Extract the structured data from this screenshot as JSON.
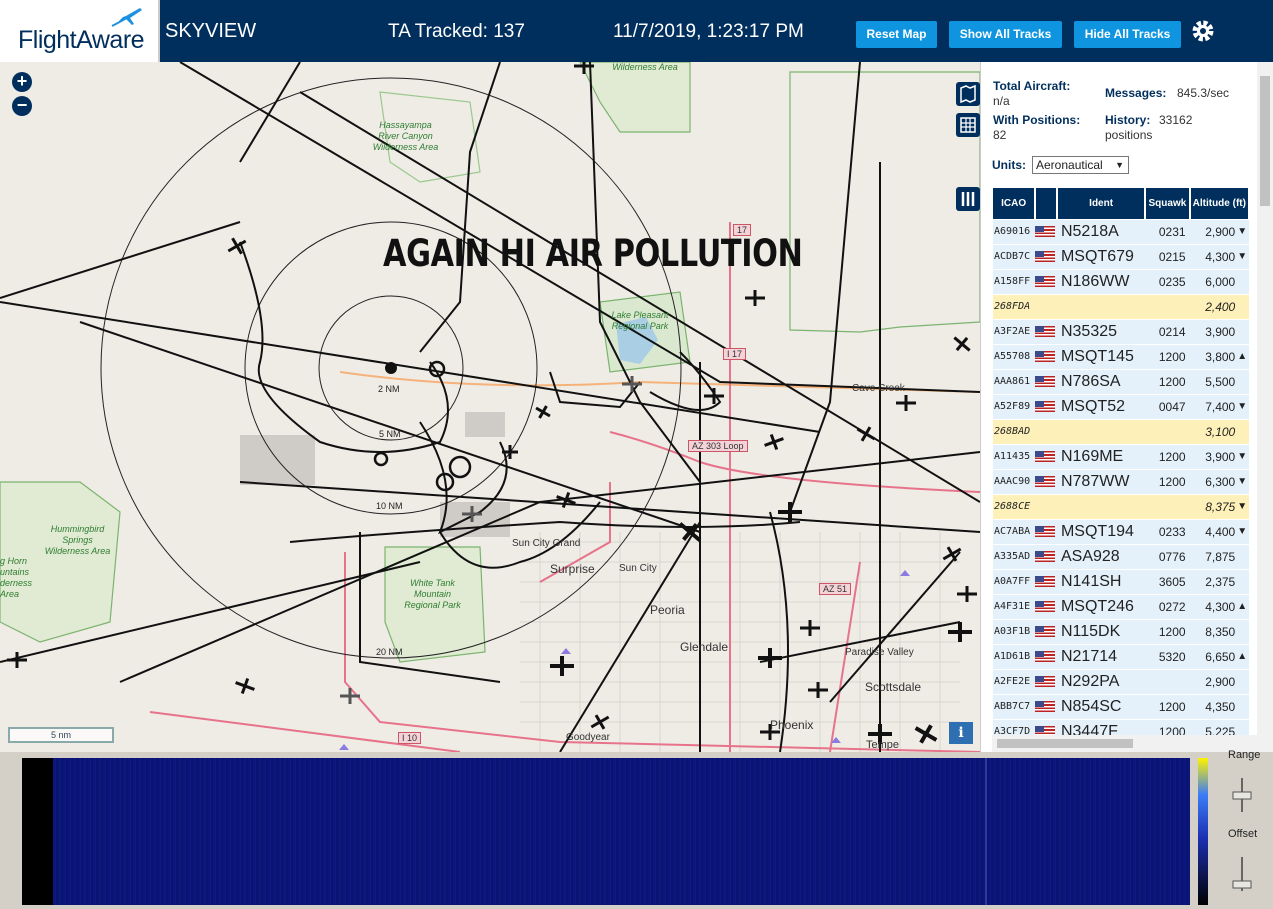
{
  "header": {
    "logo": "FlightAware",
    "app_title": "SKYVIEW",
    "ta_tracked": "TA Tracked: 137",
    "clock": "11/7/2019, 1:23:17 PM",
    "buttons": {
      "reset": "Reset Map",
      "show": "Show All Tracks",
      "hide": "Hide All Tracks"
    },
    "icons": [
      "plane-logo-icon",
      "gear-icon"
    ],
    "colors": {
      "header_bg": "#002f5d",
      "button": "#0f95e0"
    }
  },
  "map": {
    "zoom_in": "+",
    "zoom_out": "−",
    "overlay": "AGAIN HI AIR POLLUTION",
    "scale": "5 nm",
    "info": "i",
    "rings": [
      "2 NM",
      "5 NM",
      "10 NM",
      "20 NM"
    ],
    "places": [
      "Cave Creek",
      "Sun City Grand",
      "Surprise",
      "Sun City",
      "Peoria",
      "Glendale",
      "Paradise Valley",
      "Scottsdale",
      "Phoenix",
      "Tempe",
      "Goodyear"
    ],
    "wilderness": [
      "Wilderness Area",
      "Hassayampa River Canyon Wilderness Area",
      "Lake Pleasant Regional Park",
      "Hummingbird Springs Wilderness Area",
      "White Tank Mountain Regional Park",
      "g Horn untains derness Area"
    ],
    "shields": [
      "17",
      "I 17",
      "AZ 303 Loop",
      "AZ 51",
      "I 10"
    ],
    "icons": [
      "map-layers-icon",
      "grid-icon",
      "columns-icon"
    ]
  },
  "panel": {
    "total_label": "Total Aircraft:",
    "total_value": "n/a",
    "with_pos_label": "With Positions:",
    "with_pos_value": "82",
    "messages_label": "Messages:",
    "messages_value": "845.3/sec",
    "history_label": "History:",
    "history_value": "33162",
    "history_unit": "positions",
    "units_label": "Units:",
    "units_value": "Aeronautical",
    "columns": [
      "ICAO",
      "Ident",
      "Squawk",
      "Altitude (ft)"
    ],
    "rows": [
      {
        "icao": "A69016",
        "flag": true,
        "ident": "N5218A",
        "squawk": "0231",
        "alt": "2,900",
        "trend": "▼"
      },
      {
        "icao": "ACDB7C",
        "flag": true,
        "ident": "MSQT679",
        "squawk": "0215",
        "alt": "4,300",
        "trend": "▼"
      },
      {
        "icao": "A158FF",
        "flag": true,
        "ident": "N186WW",
        "squawk": "0235",
        "alt": "6,000",
        "trend": ""
      },
      {
        "icao": "268FDA",
        "flag": false,
        "ident": "",
        "squawk": "",
        "alt": "2,400",
        "trend": ""
      },
      {
        "icao": "A3F2AE",
        "flag": true,
        "ident": "N35325",
        "squawk": "0214",
        "alt": "3,900",
        "trend": ""
      },
      {
        "icao": "A55708",
        "flag": true,
        "ident": "MSQT145",
        "squawk": "1200",
        "alt": "3,800",
        "trend": "▲"
      },
      {
        "icao": "AAA861",
        "flag": true,
        "ident": "N786SA",
        "squawk": "1200",
        "alt": "5,500",
        "trend": ""
      },
      {
        "icao": "A52F89",
        "flag": true,
        "ident": "MSQT52",
        "squawk": "0047",
        "alt": "7,400",
        "trend": "▼"
      },
      {
        "icao": "268BAD",
        "flag": false,
        "ident": "",
        "squawk": "",
        "alt": "3,100",
        "trend": ""
      },
      {
        "icao": "A11435",
        "flag": true,
        "ident": "N169ME",
        "squawk": "1200",
        "alt": "3,900",
        "trend": "▼"
      },
      {
        "icao": "AAAC90",
        "flag": true,
        "ident": "N787WW",
        "squawk": "1200",
        "alt": "6,300",
        "trend": "▼"
      },
      {
        "icao": "2688CE",
        "flag": false,
        "ident": "",
        "squawk": "",
        "alt": "8,375",
        "trend": "▼"
      },
      {
        "icao": "AC7ABA",
        "flag": true,
        "ident": "MSQT194",
        "squawk": "0233",
        "alt": "4,400",
        "trend": "▼"
      },
      {
        "icao": "A335AD",
        "flag": true,
        "ident": "ASA928",
        "squawk": "0776",
        "alt": "7,875",
        "trend": ""
      },
      {
        "icao": "A0A7FF",
        "flag": true,
        "ident": "N141SH",
        "squawk": "3605",
        "alt": "2,375",
        "trend": ""
      },
      {
        "icao": "A4F31E",
        "flag": true,
        "ident": "MSQT246",
        "squawk": "0272",
        "alt": "4,300",
        "trend": "▲"
      },
      {
        "icao": "A03F1B",
        "flag": true,
        "ident": "N115DK",
        "squawk": "1200",
        "alt": "8,350",
        "trend": ""
      },
      {
        "icao": "A1D61B",
        "flag": true,
        "ident": "N21714",
        "squawk": "5320",
        "alt": "6,650",
        "trend": "▲"
      },
      {
        "icao": "A2FE2E",
        "flag": true,
        "ident": "N292PA",
        "squawk": "",
        "alt": "2,900",
        "trend": ""
      },
      {
        "icao": "ABB7C7",
        "flag": true,
        "ident": "N854SC",
        "squawk": "1200",
        "alt": "4,350",
        "trend": ""
      },
      {
        "icao": "A3CF7D",
        "flag": true,
        "ident": "N3447F",
        "squawk": "1200",
        "alt": "5,225",
        "trend": ""
      }
    ]
  },
  "waterfall": {
    "range_label": "Range",
    "offset_label": "Offset"
  }
}
